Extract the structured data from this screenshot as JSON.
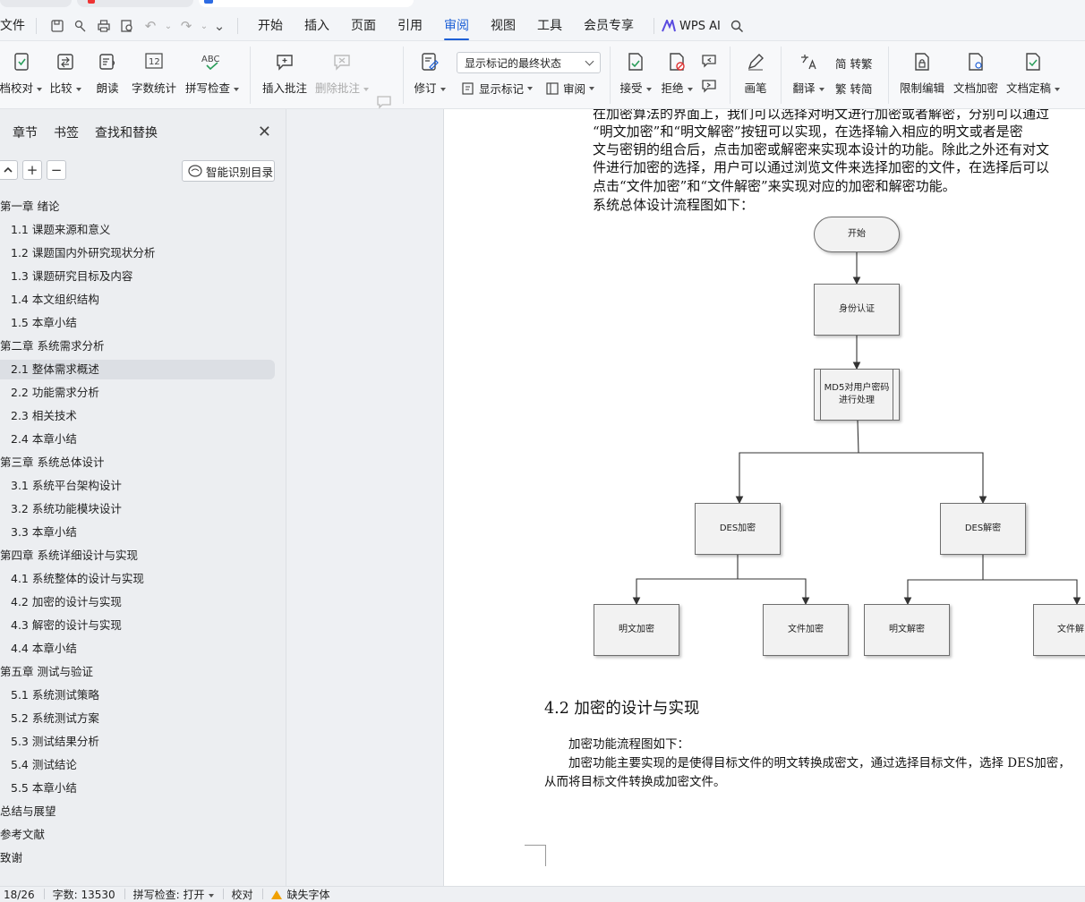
{
  "titlebar": {
    "file_menu": "文件",
    "tabs": [
      "开始",
      "插入",
      "页面",
      "引用",
      "审阅",
      "视图",
      "工具",
      "会员专享"
    ],
    "active_tab": "审阅",
    "wps_ai": "WPS AI"
  },
  "ribbon": {
    "doc_check": "文档校对",
    "compare": "比较",
    "read_aloud": "朗读",
    "word_count": "字数统计",
    "spell_check": "拼写检查",
    "insert_comment": "插入批注",
    "delete_comment": "删除批注",
    "track_changes": "修订",
    "markup_state": "显示标记的最终状态",
    "show_markup": "显示标记",
    "review_pane": "审阅",
    "accept": "接受",
    "reject": "拒绝",
    "ink": "画笔",
    "translate": "翻译",
    "to_traditional": "简 转繁",
    "to_simplified": "繁 转简",
    "restrict_edit": "限制编辑",
    "encrypt": "文档加密",
    "finalize": "文档定稿"
  },
  "nav": {
    "tabs": [
      "章节",
      "书签",
      "查找和替换"
    ],
    "smart_toc": "智能识别目录",
    "items": [
      {
        "label": "第一章  绪论",
        "level": 1
      },
      {
        "label": "1.1  课题来源和意义",
        "level": 2
      },
      {
        "label": "1.2  课题国内外研究现状分析",
        "level": 2
      },
      {
        "label": "1.3  课题研究目标及内容",
        "level": 2
      },
      {
        "label": "1.4  本文组织结构",
        "level": 2
      },
      {
        "label": "1.5 本章小结",
        "level": 2
      },
      {
        "label": "第二章  系统需求分析",
        "level": 1
      },
      {
        "label": "2.1  整体需求概述",
        "level": 2,
        "selected": true
      },
      {
        "label": "2.2  功能需求分析",
        "level": 2
      },
      {
        "label": "2.3  相关技术",
        "level": 2
      },
      {
        "label": "2.4  本章小结",
        "level": 2
      },
      {
        "label": "第三章  系统总体设计",
        "level": 1
      },
      {
        "label": "3.1 系统平台架构设计",
        "level": 2
      },
      {
        "label": "3.2  系统功能模块设计",
        "level": 2
      },
      {
        "label": "3.3  本章小结",
        "level": 2
      },
      {
        "label": "第四章  系统详细设计与实现",
        "level": 1
      },
      {
        "label": "4.1 系统整体的设计与实现",
        "level": 2
      },
      {
        "label": "4.2  加密的设计与实现",
        "level": 2
      },
      {
        "label": "4.3  解密的设计与实现",
        "level": 2
      },
      {
        "label": "4.4  本章小结",
        "level": 2
      },
      {
        "label": "第五章  测试与验证",
        "level": 1
      },
      {
        "label": "5.1  系统测试策略",
        "level": 2
      },
      {
        "label": "5.2  系统测试方案",
        "level": 2
      },
      {
        "label": "5.3  测试结果分析",
        "level": 2
      },
      {
        "label": "5.4  测试结论",
        "level": 2
      },
      {
        "label": "5.5  本章小结",
        "level": 2
      },
      {
        "label": "总结与展望",
        "level": 1
      },
      {
        "label": "参考文献",
        "level": 1
      },
      {
        "label": "致谢",
        "level": 1
      }
    ]
  },
  "document": {
    "lines": [
      "在加密算法的界面上，我们可以选择对明文进行加密或者解密，分别可以通过",
      "“明文加密”和“明文解密”按钮可以实现，在选择输入相应的明文或者是密",
      "文与密钥的组合后，点击加密或解密来实现本设计的功能。除此之外还有对文",
      "件进行加密的选择，用户可以通过浏览文件来选择加密的文件，在选择后可以",
      "点击“文件加密”和“文件解密”来实现对应的加密和解密功能。",
      "系统总体设计流程图如下："
    ],
    "flowchart": {
      "start": "开始",
      "auth": "身份认证",
      "md5": "MD5对用户密码进行处理",
      "des_encrypt": "DES加密",
      "des_decrypt": "DES解密",
      "plain_encrypt": "明文加密",
      "file_encrypt": "文件加密",
      "plain_decrypt": "明文解密",
      "file_decrypt": "文件解"
    },
    "section_heading": "4.2  加密的设计与实现",
    "para2_line1": "加密功能流程图如下：",
    "para3_line1": "加密功能主要实现的是使得目标文件的明文转换成密文，通过选择目标文件，选择 DES加密，",
    "para3_line2": "从而将目标文件转换成加密文件。"
  },
  "status": {
    "page": "18/26",
    "word_count": "字数: 13530",
    "spell_check": "拼写检查: 打开",
    "proofread": "校对",
    "missing_fonts": "缺失字体"
  }
}
